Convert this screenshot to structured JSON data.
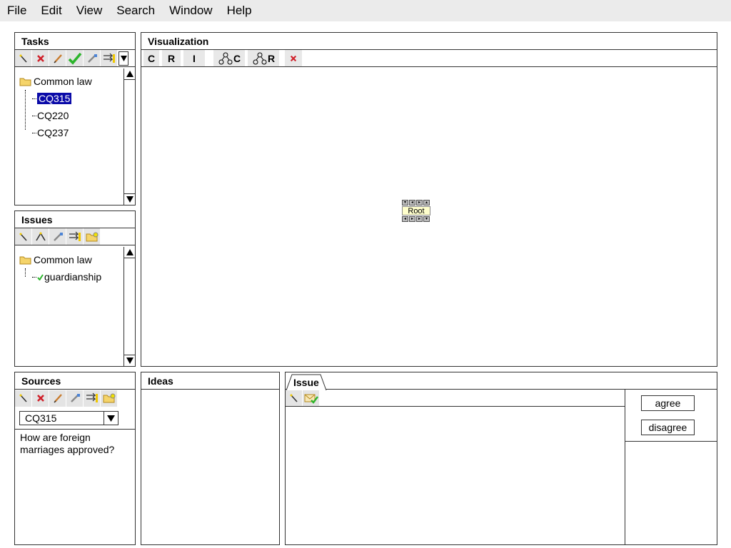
{
  "menu": [
    "File",
    "Edit",
    "View",
    "Search",
    "Window",
    "Help"
  ],
  "tasks": {
    "title": "Tasks",
    "folder": "Common law",
    "items": [
      "CQ315",
      "CQ220",
      "CQ237"
    ],
    "selected": "CQ315"
  },
  "issues": {
    "title": "Issues",
    "folder": "Common law",
    "items": [
      "guardianship"
    ]
  },
  "visualization": {
    "title": "Visualization",
    "buttons": {
      "c": "C",
      "r": "R",
      "i": "I",
      "tree_c": "C",
      "tree_r": "R"
    },
    "root_label": "Root"
  },
  "sources": {
    "title": "Sources",
    "selected": "CQ315",
    "text": "How are foreign marriages approved?"
  },
  "ideas": {
    "title": "Ideas"
  },
  "issue_panel": {
    "tab_label": "Issue",
    "agree_label": "agree",
    "disagree_label": "disagree"
  },
  "colors": {
    "selection": "#0a0aa8",
    "toolbar_bg": "#e4e4e4",
    "menubar_bg": "#ebebeb",
    "node_bg": "#ffffcc",
    "check_green": "#2cb52c",
    "delete_red": "#d0202a"
  },
  "icons": [
    "magic-wand-icon",
    "delete-icon",
    "pencil-icon",
    "check-icon",
    "brush-icon",
    "arrows-icon",
    "folder-add-icon",
    "tree-icon",
    "envelope-check-icon"
  ]
}
